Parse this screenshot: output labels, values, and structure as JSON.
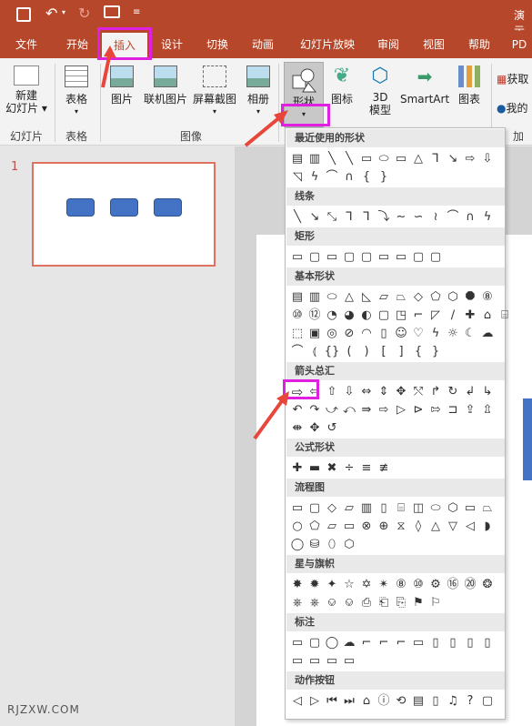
{
  "titlebar": {
    "title": "演示"
  },
  "tabs": [
    "文件",
    "开始",
    "插入",
    "设计",
    "切换",
    "动画",
    "幻灯片放映",
    "审阅",
    "视图",
    "帮助",
    "PD"
  ],
  "ribbon": {
    "new_slide": "新建\n幻灯片",
    "new_slide_l1": "新建",
    "new_slide_l2": "幻灯片 ▾",
    "table": "表格",
    "picture": "图片",
    "online_picture": "联机图片",
    "screenshot": "屏幕截图",
    "album": "相册",
    "shapes": "形状",
    "icons": "图标",
    "model3d_l1": "3D",
    "model3d_l2": "模型",
    "smartart": "SmartArt",
    "chart": "图表",
    "get": "获取",
    "my": "我的",
    "groups": {
      "slides": "幻灯片",
      "tables": "表格",
      "images": "图像",
      "add": "加"
    }
  },
  "slides_panel": {
    "slide_number": "1"
  },
  "shapes_menu": {
    "sections": [
      "最近使用的形状",
      "线条",
      "矩形",
      "基本形状",
      "箭头总汇",
      "公式形状",
      "流程图",
      "星与旗帜",
      "标注",
      "动作按钮"
    ]
  },
  "watermark": "RJZXW.COM"
}
